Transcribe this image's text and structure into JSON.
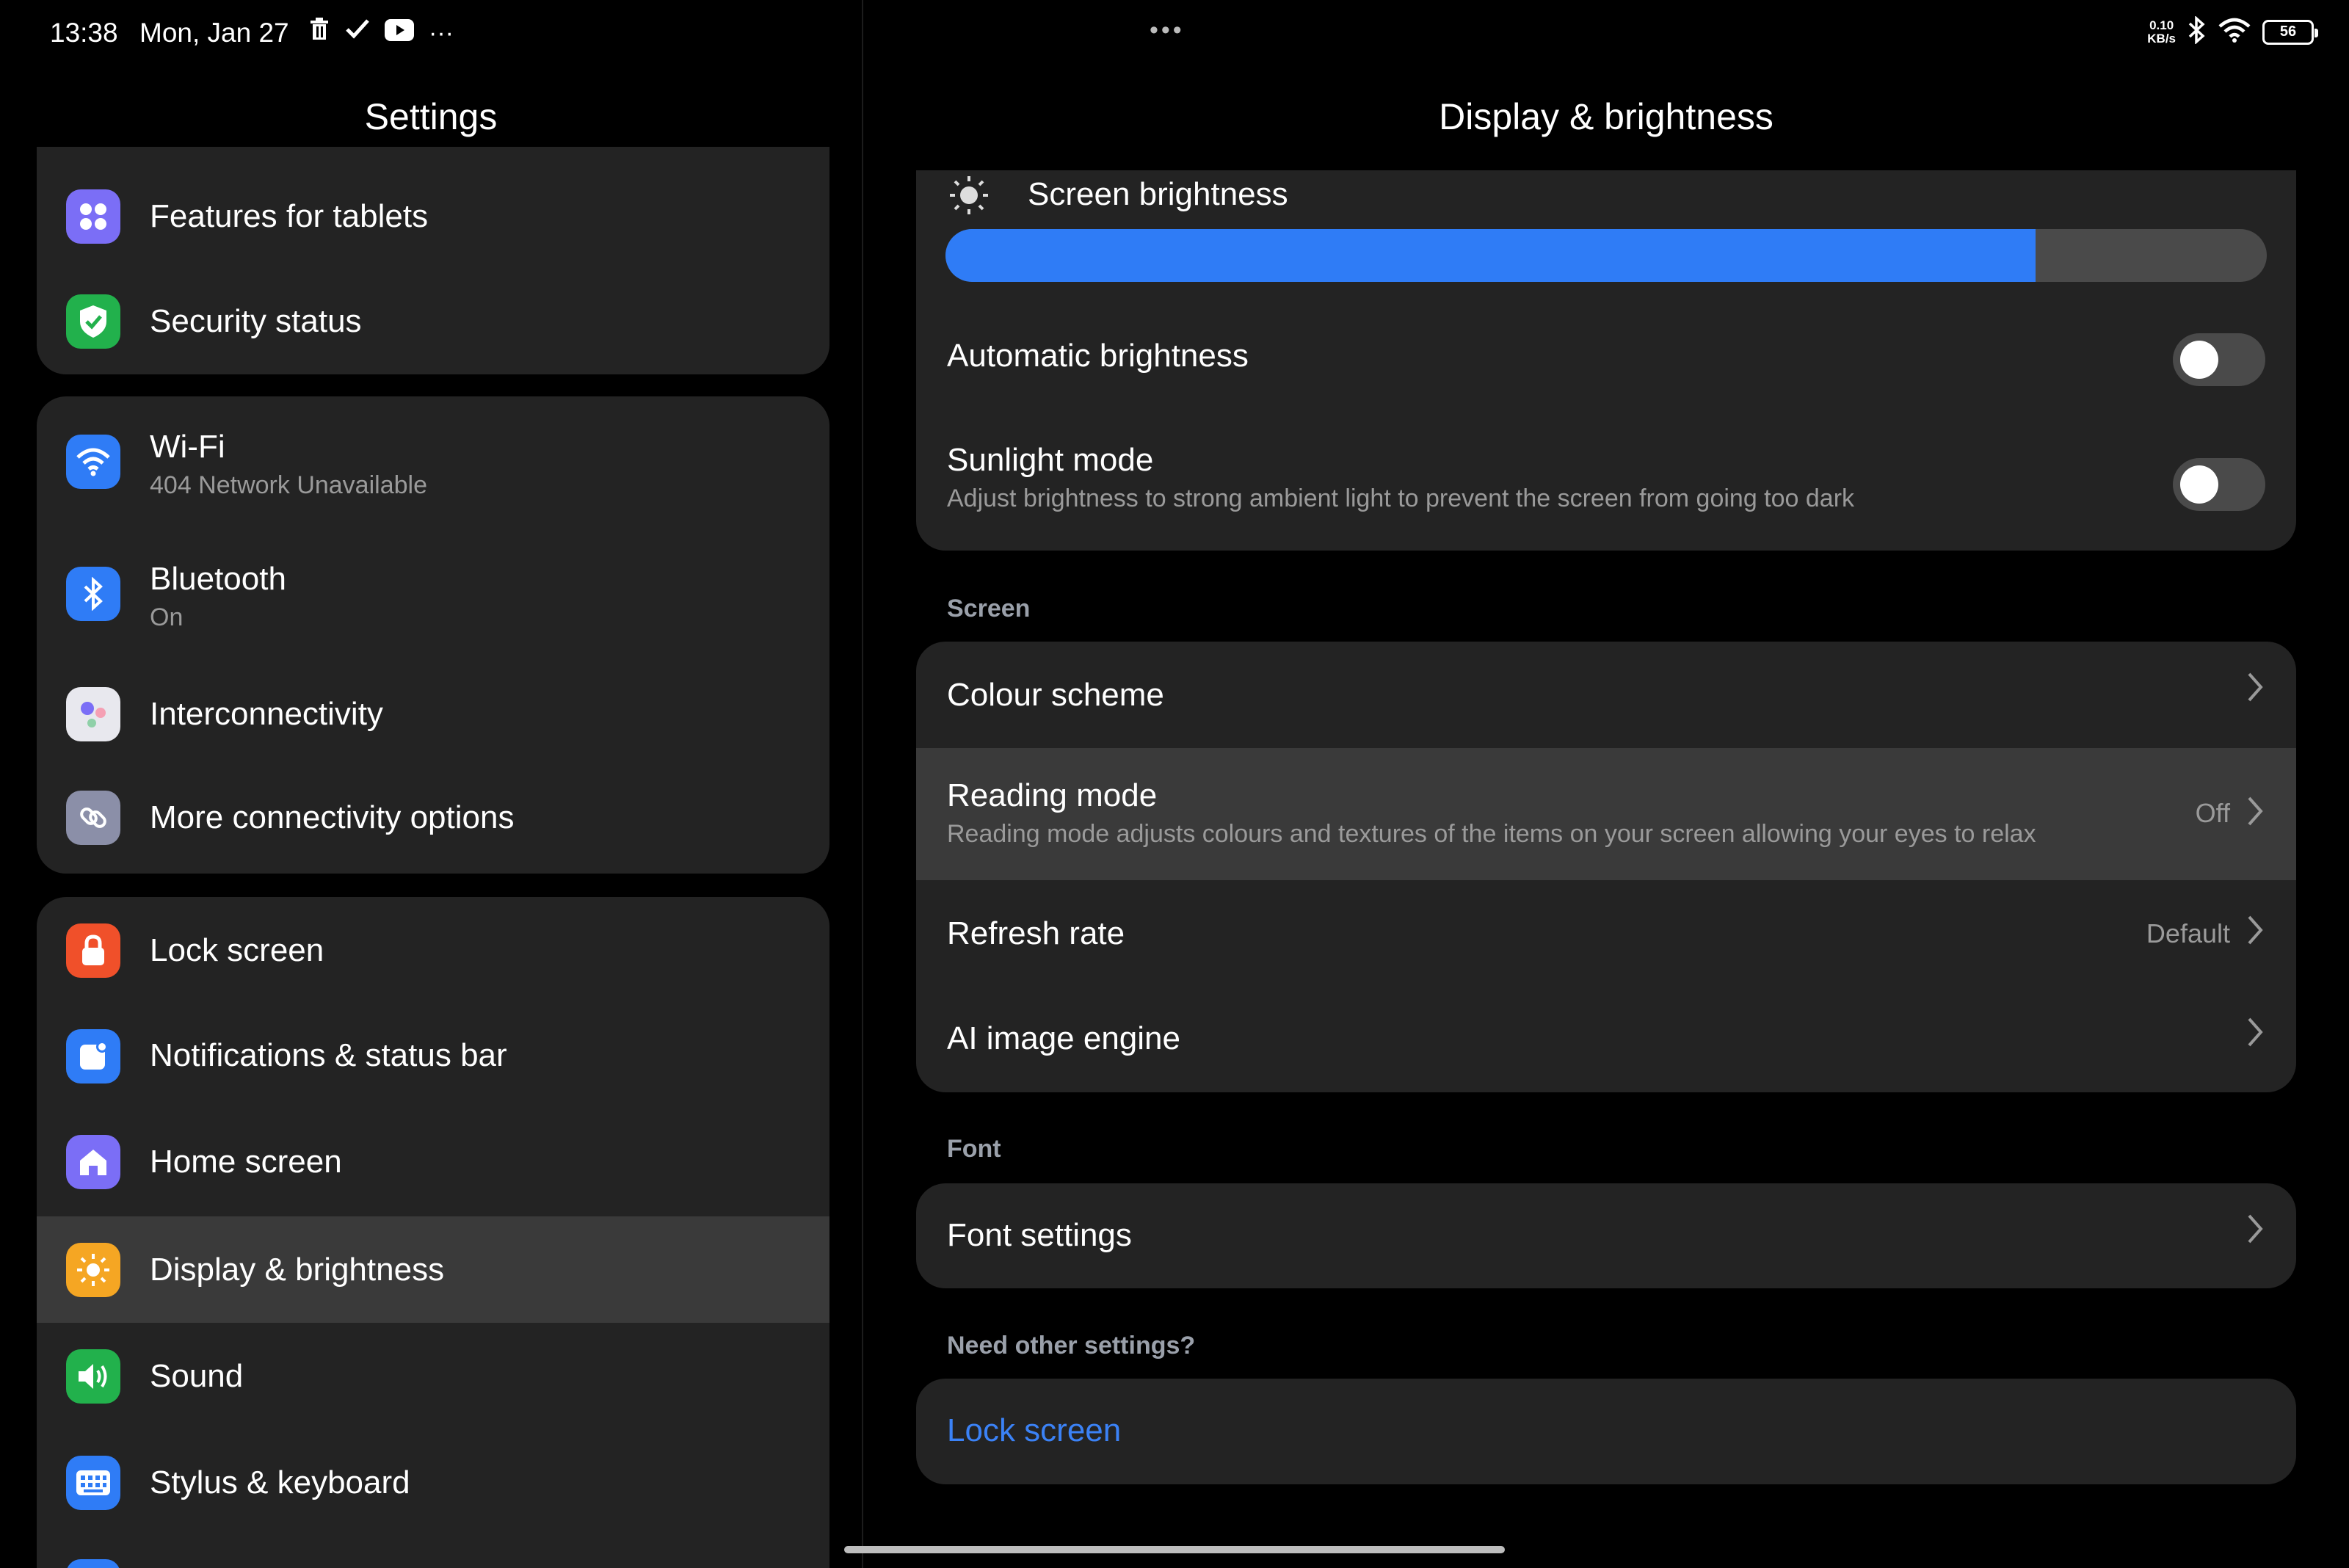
{
  "status_bar": {
    "time": "13:38",
    "date": "Mon, Jan 27",
    "left_icons": [
      "trash-icon",
      "check-icon",
      "youtube-icon",
      "more-icon"
    ],
    "more_glyph": "···",
    "center_dots": "•••",
    "net_speed_value": "0.10",
    "net_speed_unit": "KB/s",
    "battery": "56"
  },
  "left_pane": {
    "title": "Settings",
    "groups": [
      {
        "items": [
          {
            "label": "Features for tablets",
            "icon": "tablet-features-icon",
            "icon_color": "#7b6ef6"
          },
          {
            "label": "Security status",
            "icon": "shield-check-icon",
            "icon_color": "#22b14c"
          }
        ]
      },
      {
        "items": [
          {
            "label": "Wi-Fi",
            "sub": "404 Network Unavailable",
            "icon": "wifi-icon",
            "icon_color": "#2f7cf6"
          },
          {
            "label": "Bluetooth",
            "sub": "On",
            "icon": "bluetooth-icon",
            "icon_color": "#2f7cf6"
          },
          {
            "label": "Interconnectivity",
            "icon": "interconnectivity-icon",
            "icon_color": "#e8e8ee"
          },
          {
            "label": "More connectivity options",
            "icon": "link-icon",
            "icon_color": "#8b8fa8"
          }
        ]
      },
      {
        "items": [
          {
            "label": "Lock screen",
            "icon": "lock-icon",
            "icon_color": "#f0502a"
          },
          {
            "label": "Notifications & status bar",
            "icon": "notification-icon",
            "icon_color": "#2f7cf6"
          },
          {
            "label": "Home screen",
            "icon": "home-icon",
            "icon_color": "#7b6ef6"
          },
          {
            "label": "Display & brightness",
            "icon": "sun-icon",
            "icon_color": "#f5a623",
            "selected": true
          },
          {
            "label": "Sound",
            "icon": "speaker-icon",
            "icon_color": "#22b14c"
          },
          {
            "label": "Stylus & keyboard",
            "icon": "keyboard-icon",
            "icon_color": "#2f7cf6"
          }
        ]
      }
    ]
  },
  "right_pane": {
    "title": "Display & brightness",
    "brightness": {
      "label": "Screen brightness",
      "level_percent": 82.5,
      "accent": "#2f7cf6"
    },
    "automatic_brightness": {
      "label": "Automatic brightness",
      "enabled": false
    },
    "sunlight_mode": {
      "label": "Sunlight mode",
      "sub": "Adjust brightness to strong ambient light to prevent the screen from going too dark",
      "enabled": false
    },
    "screen_section": "Screen",
    "screen_items": [
      {
        "label": "Colour scheme",
        "value": ""
      },
      {
        "label": "Reading mode",
        "sub": "Reading mode adjusts colours and textures of the items on your screen allowing your eyes to relax",
        "value": "Off",
        "highlighted": true
      },
      {
        "label": "Refresh rate",
        "value": "Default"
      },
      {
        "label": "AI image engine",
        "value": ""
      }
    ],
    "font_section": "Font",
    "font_items": [
      {
        "label": "Font settings"
      }
    ],
    "other_section": "Need other settings?",
    "other_link": "Lock screen"
  }
}
